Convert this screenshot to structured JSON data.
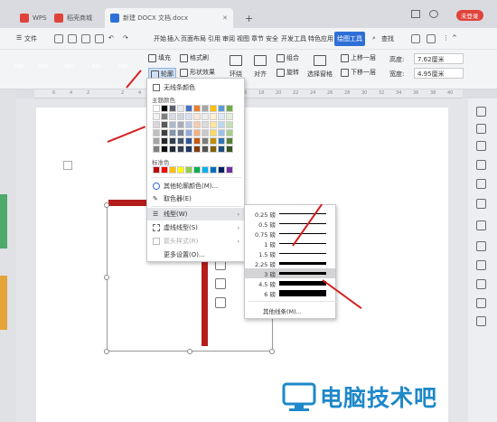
{
  "titlebar": {
    "tabs": [
      {
        "label": "WPS",
        "color": "#e0433b"
      },
      {
        "label": "稻壳商城",
        "color": "#e0433b"
      },
      {
        "label": "新建 DOCX 文档.docx",
        "color": "#2d6fd6"
      }
    ],
    "new_tab": "+",
    "unregistered_label": "未登录"
  },
  "menubar": {
    "file_label": "文件",
    "items": [
      "开始",
      "插入",
      "页面布局",
      "引用",
      "审阅",
      "视图",
      "章节",
      "安全",
      "开发工具",
      "特色应用"
    ],
    "active_item": "绘图工具",
    "search_label": "查找"
  },
  "ribbon": {
    "swatches": [
      {
        "label": "Abc",
        "color": "#1c6fc4"
      },
      {
        "label": "Abc",
        "color": "#2f86d4"
      },
      {
        "label": "Abc",
        "color": "#ee7d22"
      },
      {
        "label": "Abc",
        "color": "#9a9a9a"
      },
      {
        "label": "Abc",
        "color": "#f0c30a"
      }
    ],
    "fill_label": "填充",
    "format_painter_label": "格式刷",
    "outline_label": "轮廓",
    "shape_effect_label": "形状效果",
    "wrap_label": "环绕",
    "align_label": "对齐",
    "group_label": "组合",
    "rotate_label": "旋转",
    "selection_pane_label": "选择窗格",
    "bring_forward_label": "上移一层",
    "send_backward_label": "下移一层",
    "height_label": "高度:",
    "height_value": "7.62厘米",
    "width_label": "宽度:",
    "width_value": "4.95厘米"
  },
  "ruler": {
    "ticks": [
      "6",
      "4",
      "2",
      "",
      "2",
      "4",
      "6",
      "8",
      "10",
      "12",
      "14",
      "16",
      "18",
      "20",
      "22",
      "24",
      "26",
      "28",
      "30",
      "32",
      "34",
      "36",
      "38",
      "40"
    ]
  },
  "outline_menu": {
    "no_line_label": "无线条颜色",
    "theme_colors_label": "主题颜色",
    "theme_colors": [
      [
        "#ffffff",
        "#000000",
        "#5a6170",
        "#e8eaed",
        "#4472c4",
        "#ed7d31",
        "#a5a5a5",
        "#ffc000",
        "#5b9bd5",
        "#70ad47"
      ],
      [
        "#f2f2f2",
        "#7f7f7f",
        "#d6dce4",
        "#d0d4da",
        "#d9e1f2",
        "#fbe4d5",
        "#ededed",
        "#fff2cc",
        "#deebf6",
        "#e2efd9"
      ],
      [
        "#d8d8d8",
        "#595959",
        "#adb9ca",
        "#a6adb7",
        "#b4c6e7",
        "#f7caac",
        "#dbdbdb",
        "#fee599",
        "#bdd7ee",
        "#c5e0b3"
      ],
      [
        "#bfbfbf",
        "#3f3f3f",
        "#8496b0",
        "#7d8796",
        "#8eaadb",
        "#f4b183",
        "#c9c9c9",
        "#ffd965",
        "#9cc3e5",
        "#a8d08d"
      ],
      [
        "#a5a5a5",
        "#262626",
        "#323f4f",
        "#44546a",
        "#2f5496",
        "#c55a11",
        "#7b7b7b",
        "#bf9000",
        "#2e75b5",
        "#538135"
      ],
      [
        "#7f7f7f",
        "#0c0c0c",
        "#222a35",
        "#333f4f",
        "#1f3864",
        "#833c0b",
        "#525252",
        "#7f6000",
        "#1f4e79",
        "#375623"
      ]
    ],
    "standard_colors_label": "标准色",
    "standard_colors": [
      "#c00000",
      "#ff0000",
      "#ffc000",
      "#ffff00",
      "#92d050",
      "#00b050",
      "#00b0f0",
      "#0070c0",
      "#002060",
      "#7030a0"
    ],
    "more_colors_label": "其他轮廓颜色(M)...",
    "eyedropper_label": "取色器(E)",
    "line_type_label": "线型(W)",
    "dash_type_label": "虚线线型(S)",
    "arrow_style_label": "箭头样式(R)",
    "more_settings_label": "更多设置(O)..."
  },
  "line_weights": {
    "items": [
      {
        "label": "0.25 磅",
        "weight": 0.25
      },
      {
        "label": "0.5 磅",
        "weight": 0.5
      },
      {
        "label": "0.75 磅",
        "weight": 0.75
      },
      {
        "label": "1 磅",
        "weight": 1
      },
      {
        "label": "1.5 磅",
        "weight": 1.5
      },
      {
        "label": "2.25 磅",
        "weight": 2.25
      },
      {
        "label": "3 磅",
        "weight": 3,
        "selected": true
      },
      {
        "label": "4.5 磅",
        "weight": 4.5
      },
      {
        "label": "6 磅",
        "weight": 6
      }
    ],
    "other_label": "其他线条(M)..."
  },
  "watermark": {
    "text": "电脑技术吧"
  },
  "colors": {
    "accent_red": "#b51c1c",
    "arrow_red": "#d42020",
    "watermark_blue": "#1e88c8"
  }
}
